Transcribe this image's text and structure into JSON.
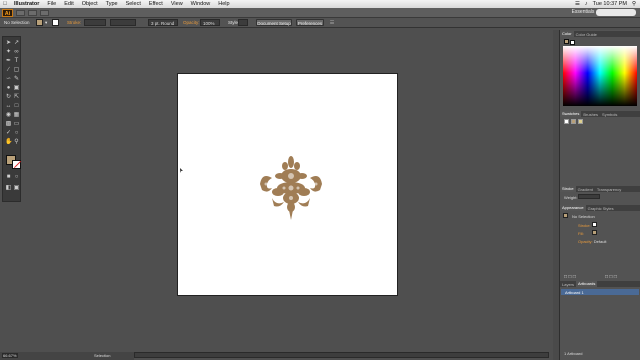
{
  "menubar": {
    "app": "Illustrator",
    "items": [
      "File",
      "Edit",
      "Object",
      "Type",
      "Select",
      "Effect",
      "View",
      "Window",
      "Help"
    ],
    "clock": "Tue 10:37 PM"
  },
  "appbar": {
    "logo": "Ai",
    "workspace": "Essentials"
  },
  "control": {
    "selection": "No Selection",
    "stroke_label": "Stroke:",
    "brush_value": "3 pt. Round",
    "opacity_label": "Opacity:",
    "opacity_value": "100%",
    "style_label": "Style:",
    "doc_setup": "Document Setup",
    "preferences": "Preferences"
  },
  "colors": {
    "fill": "#b8a079",
    "accent": "#e89a3c"
  },
  "panels": {
    "color_tabs": [
      "Color",
      "Color Guide"
    ],
    "swatch_tabs": [
      "Swatches",
      "Brushes",
      "Symbols"
    ],
    "stroke_tabs": [
      "Stroke",
      "Gradient",
      "Transparency"
    ],
    "weight_label": "Weight:",
    "appearance_tabs": [
      "Appearance",
      "Graphic Styles"
    ],
    "appearance": {
      "header": "No Selection",
      "rows": [
        {
          "label": "Stroke:"
        },
        {
          "label": "Fill:"
        },
        {
          "label": "Opacity:",
          "value": "Default"
        }
      ]
    },
    "layers_tabs": [
      "Layers",
      "Artboards"
    ],
    "artboard_item": "Artboard 1",
    "artboards_footer": "1 Artboard"
  },
  "status": {
    "zoom": "66.67%",
    "mode": "Selection"
  }
}
